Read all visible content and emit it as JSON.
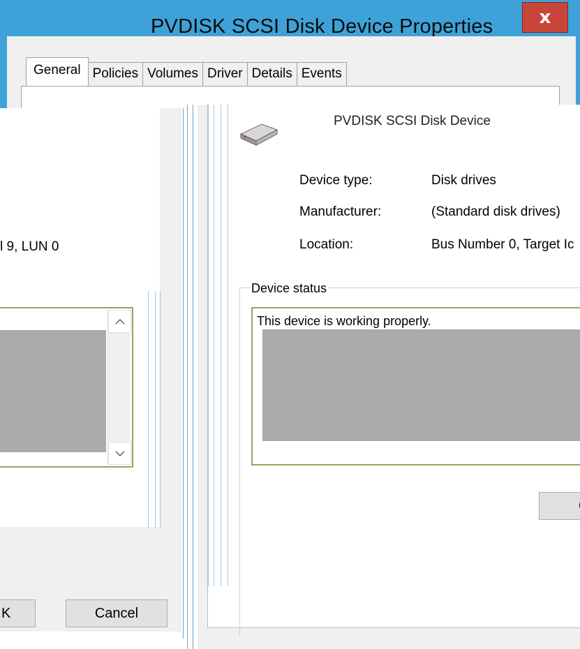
{
  "window": {
    "title": "PVDISK SCSI Disk Device Properties",
    "close_glyph": "x",
    "accent_color": "#3ea2d8",
    "close_color": "#c8453a"
  },
  "tabs": [
    "General",
    "Policies",
    "Volumes",
    "Driver",
    "Details",
    "Events"
  ],
  "left_dialog": {
    "location_fragment": "l 9, LUN 0",
    "scroll_up_glyph": "^",
    "scroll_down_glyph": "v",
    "ok_label": "K",
    "cancel_label": "Cancel"
  },
  "right_dialog": {
    "device_name": "PVDISK SCSI Disk Device",
    "device_icon": "disk-drive-icon",
    "properties": {
      "device_type_label": "Device type:",
      "device_type_value": "Disk drives",
      "manufacturer_label": "Manufacturer:",
      "manufacturer_value": "(Standard disk drives)",
      "location_label": "Location:",
      "location_value": "Bus Number 0, Target Ic"
    },
    "status_group_label": "Device status",
    "status_text": "This device is working properly.",
    "ok_label": "O"
  }
}
